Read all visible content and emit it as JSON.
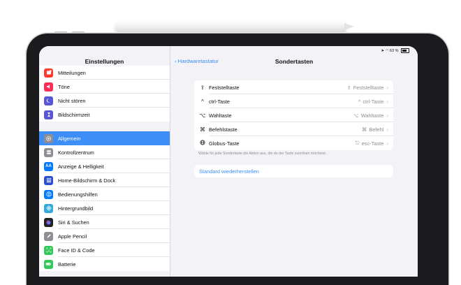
{
  "status": {
    "battery": "63 %"
  },
  "sidebar": {
    "title": "Einstellungen",
    "groups": [
      [
        {
          "label": "Mitteilungen",
          "icon": "notifications-icon",
          "color": "#ff3b30"
        },
        {
          "label": "Töne",
          "icon": "sounds-icon",
          "color": "#ff2d55"
        },
        {
          "label": "Nicht stören",
          "icon": "moon-icon",
          "color": "#5856d6"
        },
        {
          "label": "Bildschirmzeit",
          "icon": "hourglass-icon",
          "color": "#5856d6"
        }
      ],
      [
        {
          "label": "Allgemein",
          "icon": "gear-icon",
          "color": "#8e8e93",
          "selected": true
        },
        {
          "label": "Kontrollzentrum",
          "icon": "toggles-icon",
          "color": "#8e8e93"
        },
        {
          "label": "Anzeige & Helligkeit",
          "icon": "aa-icon",
          "color": "#007aff"
        },
        {
          "label": "Home-Bildschirm & Dock",
          "icon": "grid-icon",
          "color": "#2c4fd6"
        },
        {
          "label": "Bedienungshilfen",
          "icon": "accessibility-icon",
          "color": "#007aff"
        },
        {
          "label": "Hintergrundbild",
          "icon": "flower-icon",
          "color": "#34aadc"
        },
        {
          "label": "Siri & Suchen",
          "icon": "siri-icon",
          "color": "#222222"
        },
        {
          "label": "Apple Pencil",
          "icon": "pencil-icon",
          "color": "#8e8e93"
        },
        {
          "label": "Face ID & Code",
          "icon": "faceid-icon",
          "color": "#34c759"
        },
        {
          "label": "Batterie",
          "icon": "battery-icon",
          "color": "#34c759"
        }
      ]
    ]
  },
  "detail": {
    "back_label": "Hardwaretastatur",
    "title": "Sondertasten",
    "keys": [
      {
        "label": "Feststelltaste",
        "icon": "capslock-icon",
        "value": "Feststelltaste",
        "value_icon": "capslock-icon"
      },
      {
        "label": "ctrl-Taste",
        "icon": "control-icon",
        "value": "ctrl-Taste",
        "value_icon": "control-icon"
      },
      {
        "label": "Wahltaste",
        "icon": "option-icon",
        "value": "Wahltaste",
        "value_icon": "option-icon"
      },
      {
        "label": "Befehlstaste",
        "icon": "command-icon",
        "value": "Befehl",
        "value_icon": "command-icon"
      },
      {
        "label": "Globus-Taste",
        "icon": "globe-icon",
        "value": "esc-Taste",
        "value_icon": "escape-icon"
      }
    ],
    "footnote": "Wähle für jede Sondertaste die Aktion aus, die du der Taste zuordnen möchtest.",
    "reset_label": "Standard wiederherstellen"
  }
}
